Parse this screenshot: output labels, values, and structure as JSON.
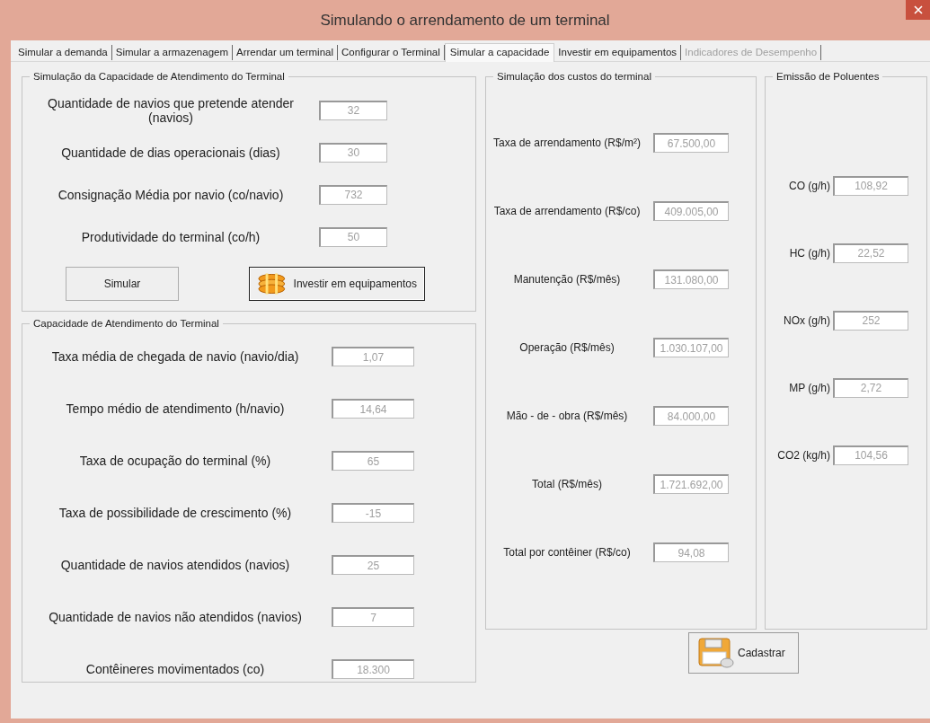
{
  "window": {
    "title": "Simulando o arrendamento de um terminal"
  },
  "tabs": [
    {
      "label": "Simular a demanda",
      "selected": false,
      "disabled": false
    },
    {
      "label": "Simular a armazenagem",
      "selected": false,
      "disabled": false
    },
    {
      "label": "Arrendar um terminal",
      "selected": false,
      "disabled": false
    },
    {
      "label": "Configurar o Terminal",
      "selected": false,
      "disabled": false
    },
    {
      "label": "Simular a capacidade",
      "selected": true,
      "disabled": false
    },
    {
      "label": "Investir em equipamentos",
      "selected": false,
      "disabled": false
    },
    {
      "label": "Indicadores de Desempenho",
      "selected": false,
      "disabled": true
    }
  ],
  "capacity_input": {
    "title": "Simulação da Capacidade de Atendimento do Terminal",
    "fields": [
      {
        "label": "Quantidade de navios que pretende atender (navios)",
        "value": "32"
      },
      {
        "label": "Quantidade de dias operacionais (dias)",
        "value": "30"
      },
      {
        "label": "Consignação Média  por navio (co/navio)",
        "value": "732"
      },
      {
        "label": "Produtividade do terminal  (co/h)",
        "value": "50"
      }
    ],
    "buttons": [
      {
        "label": "Simular",
        "kind": "plain"
      },
      {
        "label": "Investir em equipamentos",
        "kind": "invest"
      }
    ]
  },
  "capacity_results": {
    "title": "Capacidade de Atendimento do Terminal",
    "fields": [
      {
        "label": "Taxa média de chegada de navio  (navio/dia)",
        "value": "1,07"
      },
      {
        "label": "Tempo médio de atendimento (h/navio)",
        "value": "14,64"
      },
      {
        "label": "Taxa de ocupação do terminal (%)",
        "value": "65"
      },
      {
        "label": "Taxa de possibilidade de crescimento (%)",
        "value": "-15"
      },
      {
        "label": "Quantidade de navios atendidos (navios)",
        "value": "25"
      },
      {
        "label": "Quantidade de navios não atendidos (navios)",
        "value": "7"
      },
      {
        "label": "Contêineres movimentados (co)",
        "value": "18.300"
      }
    ]
  },
  "costs": {
    "title": "Simulação dos custos do terminal",
    "fields": [
      {
        "label": "Taxa de arrendamento (R$/m²)",
        "value": "67.500,00"
      },
      {
        "label": "Taxa de arrendamento (R$/co)",
        "value": "409.005,00"
      },
      {
        "label": "Manutenção (R$/mês)",
        "value": "131.080,00"
      },
      {
        "label": "Operação (R$/mês)",
        "value": "1.030.107,00"
      },
      {
        "label": "Mão - de - obra (R$/mês)",
        "value": "84.000,00"
      },
      {
        "label": "Total (R$/mês)",
        "value": "1.721.692,00"
      },
      {
        "label": "Total por contêiner (R$/co)",
        "value": "94,08"
      }
    ]
  },
  "emissions": {
    "title": "Emissão de Poluentes",
    "fields": [
      {
        "label": "CO (g/h)",
        "value": "108,92"
      },
      {
        "label": "HC (g/h)",
        "value": "22,52"
      },
      {
        "label": "NOx (g/h)",
        "value": "252"
      },
      {
        "label": "MP (g/h)",
        "value": "2,72"
      },
      {
        "label": "CO2 (kg/h)",
        "value": "104,56"
      }
    ]
  },
  "save_button": {
    "label": "Cadastrar"
  }
}
